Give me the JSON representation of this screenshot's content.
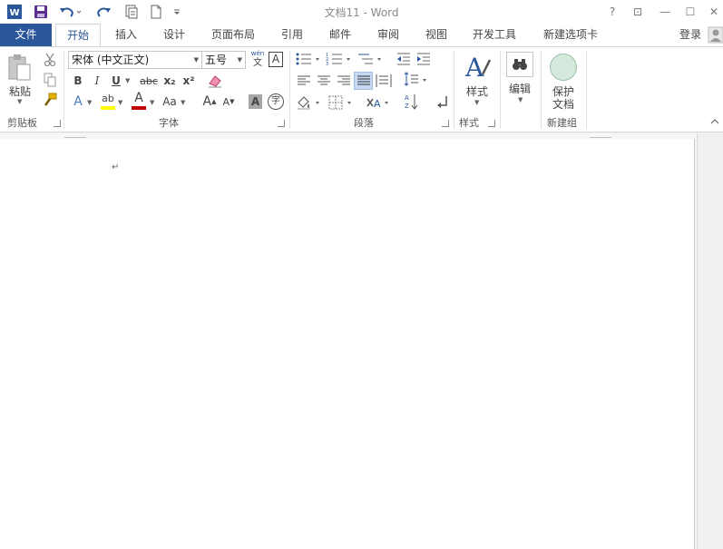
{
  "window": {
    "title": "文档11 - Word",
    "help": "?",
    "ribbon_display": "⊡",
    "minimize": "—",
    "maximize": "☐",
    "close": "✕",
    "app_icon": "W"
  },
  "quick_access": {
    "icons": [
      "word-app-icon",
      "save-icon",
      "undo-icon",
      "redo-icon",
      "touch-mode-icon",
      "new-document-icon",
      "customize-qat-icon"
    ]
  },
  "tabs": [
    {
      "label": "文件"
    },
    {
      "label": "开始"
    },
    {
      "label": "插入"
    },
    {
      "label": "设计"
    },
    {
      "label": "页面布局"
    },
    {
      "label": "引用"
    },
    {
      "label": "邮件"
    },
    {
      "label": "审阅"
    },
    {
      "label": "视图"
    },
    {
      "label": "开发工具"
    },
    {
      "label": "新建选项卡"
    }
  ],
  "account": {
    "login": "登录"
  },
  "ribbon": {
    "clipboard": {
      "label": "剪贴板",
      "paste": "粘贴"
    },
    "font": {
      "label": "字体",
      "font_name": "宋体 (中文正文)",
      "font_size": "五号",
      "bold": "B",
      "italic": "I",
      "underline": "U",
      "strikethrough": "abc",
      "subscript": "x₂",
      "superscript": "x²",
      "font_color_letter": "A",
      "highlight_letter": "ab",
      "change_case": "Aa",
      "grow_font": "A",
      "shrink_font": "A",
      "phonetic_top": "wén",
      "phonetic_bottom": "文",
      "char_border": "A",
      "char_shading": "A",
      "enclose_char": "字",
      "text_effect": "A"
    },
    "paragraph": {
      "label": "段落"
    },
    "styles": {
      "label": "样式",
      "button": "样式"
    },
    "editing": {
      "button": "编辑"
    },
    "newgroup": {
      "label": "新建组",
      "protect_line1": "保护",
      "protect_line2": "文档"
    }
  },
  "document": {
    "paragraph_mark": "↵"
  },
  "colors": {
    "accent": "#2b579a",
    "highlight": "#ffff00",
    "font_color": "#c00000",
    "selected": "#c5d9f1"
  }
}
